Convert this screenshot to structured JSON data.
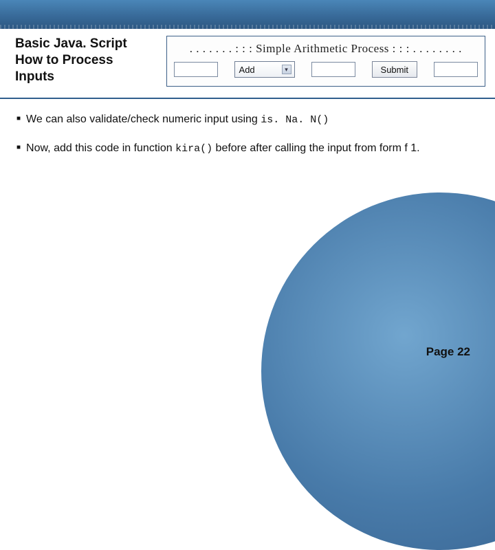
{
  "title": {
    "line1": "Basic Java. Script",
    "line2": "How to Process Inputs"
  },
  "form": {
    "caption": ". . . . . . . : : :  Simple Arithmetic Process  : : : . . . . . . . .",
    "select_value": "Add",
    "submit_label": "Submit"
  },
  "bullets": {
    "b1_pre": "We can also validate/check numeric input using ",
    "b1_code": "is. Na. N()",
    "b2_pre": "Now, add this code in function ",
    "b2_code": "kira()",
    "b2_post": " before after calling the input from form f 1."
  },
  "footer": {
    "page_label": "Page 22"
  }
}
